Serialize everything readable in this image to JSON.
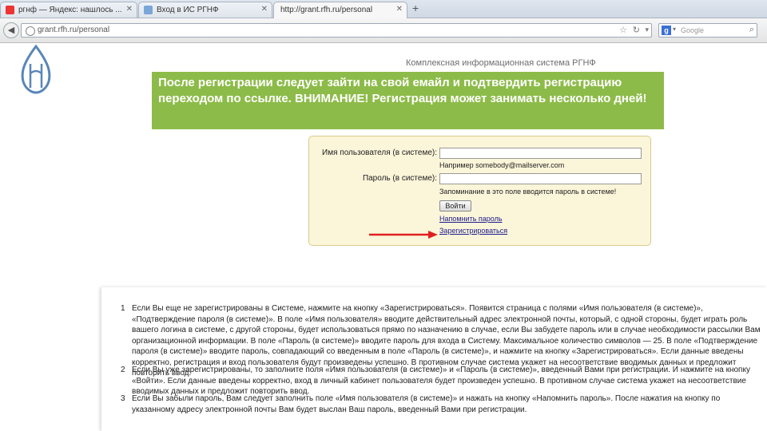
{
  "browser": {
    "tabs": [
      {
        "label": "ргнф — Яндекс: нашлось ...",
        "active": false
      },
      {
        "label": "Вход в ИС РГНФ",
        "active": false
      },
      {
        "label": "http://grant.rfh.ru/personal",
        "active": true
      }
    ],
    "new_tab_label": "+",
    "url": "grant.rfh.ru/personal",
    "search_engine": "Google",
    "colors": {
      "callout": "#8dbb49",
      "arrow": "#e02020",
      "login_bg": "#fbf5d9"
    }
  },
  "page": {
    "system_title": "Комплексная информационная система РГНФ",
    "callout": "После регистрации следует зайти на свой емайл и подтвердить регистрацию переходом по ссылке. ВНИМАНИЕ! Регистрация может занимать несколько дней!",
    "login": {
      "username_label": "Имя пользователя (в системе):",
      "username_hint": "Например somebody@mailserver.com",
      "password_label": "Пароль (в системе):",
      "password_hint": "Запоминание в это поле вводится пароль в системе!",
      "login_button": "Войти",
      "remind_link": "Напомнить пароль",
      "register_link": "Зарегистрироваться"
    },
    "instructions": [
      {
        "num": "1",
        "text": "Если Вы еще не зарегистрированы в Системе, нажмите на кнопку «Зарегистрироваться». Появится страница с полями «Имя пользователя (в системе)», «Подтверждение пароля (в системе)». В поле «Имя пользователя» вводите действительный адрес электронной почты, который, с одной стороны, будет играть роль вашего логина в системе, с другой стороны, будет использоваться прямо по назначению в случае, если Вы забудете пароль или в случае необходимости рассылки Вам организационной информации. В поле «Пароль (в системе)» вводите пароль для входа в Систему. Максимальное количество символов — 25. В поле «Подтверждение пароля (в системе)» вводите пароль, совпадающий со введенным в поле «Пароль (в системе)», и нажмите на кнопку «Зарегистрироваться». Если данные введены корректно, регистрация и вход пользователя будут произведены успешно. В противном случае система укажет на несоответствие вводимых данных и предложит повторить ввод."
      },
      {
        "num": "2",
        "text": "Если Вы уже зарегистрированы, то заполните поля «Имя пользователя (в системе)» и «Пароль (в системе)», введенный Вами при регистрации. И нажмите на кнопку «Войти». Если данные введены корректно, вход в личный кабинет пользователя будет произведен успешно. В противном случае система укажет на несоответствие вводимых данных и предложит повторить ввод."
      },
      {
        "num": "3",
        "text": "Если Вы забыли пароль, Вам следует заполнить поле «Имя пользователя (в системе)» и нажать на кнопку «Напомнить пароль». После нажатия на кнопку по указанному адресу электронной почты Вам будет выслан Ваш пароль, введенный Вами при регистрации."
      }
    ]
  }
}
